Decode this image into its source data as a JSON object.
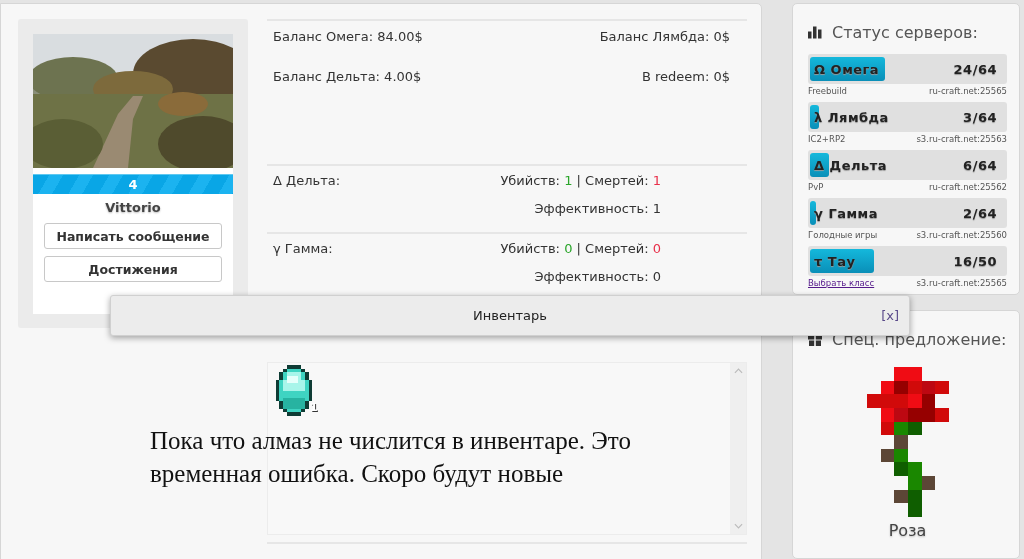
{
  "profile": {
    "level": "4",
    "name": "Vittorio",
    "buttons": [
      "Написать сообщение",
      "Достижения"
    ]
  },
  "balances": [
    "Баланс Омега: 84.00$",
    "Баланс Лямбда: 0$",
    "Баланс Дельта: 4.00$",
    "В redeem: 0$"
  ],
  "stats": [
    {
      "server": "Δ Дельта:",
      "kills_label": "Убийств:",
      "kills": "1",
      "separator": "|",
      "deaths_label": "Смертей:",
      "deaths": "1",
      "efficiency": "Эффективность: 1"
    },
    {
      "server": "γ Гамма:",
      "kills_label": "Убийств:",
      "kills": "0",
      "separator": "|",
      "deaths_label": "Смертей:",
      "deaths": "0",
      "efficiency": "Эффективность: 0"
    }
  ],
  "inventory": {
    "items": [
      {
        "kind": "diamond",
        "count": "1"
      }
    ],
    "notice": "Пока что алмаз не числится в инвентаре. Это временная ошибка. Скоро будут новые"
  },
  "dialog": {
    "title": "Инвентарь",
    "close": "[x]"
  },
  "server_status": {
    "title": "Статус серверов:",
    "servers": [
      {
        "name": "Ω Омега",
        "players": "24/64",
        "level": 0.375,
        "mode": "Freebuild",
        "kind": "text",
        "address": "ru-craft.net:25565"
      },
      {
        "name": "λ Лямбда",
        "players": "3/64",
        "level": 0.047,
        "mode": "IC2+RP2",
        "kind": "text",
        "address": "s3.ru-craft.net:25563"
      },
      {
        "name": "Δ Дельта",
        "players": "6/64",
        "level": 0.094,
        "mode": "PvP",
        "kind": "text",
        "address": "ru-craft.net:25562"
      },
      {
        "name": "γ Гамма",
        "players": "2/64",
        "level": 0.031,
        "mode": "Голодные игры",
        "kind": "text",
        "address": "s3.ru-craft.net:25560"
      },
      {
        "name": "τ Тау",
        "players": "16/50",
        "level": 0.32,
        "mode": "Выбрать класс",
        "kind": "link",
        "address": "s3.ru-craft.net:25565"
      }
    ]
  },
  "offer": {
    "title": "Спец. предложение:",
    "item": "Роза"
  }
}
